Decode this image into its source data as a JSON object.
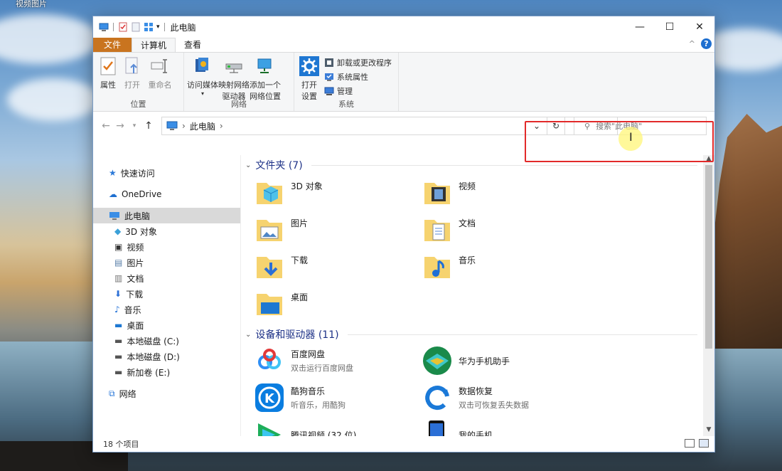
{
  "desktop": {
    "label": "视频图片"
  },
  "window": {
    "title": "此电脑",
    "controls": {
      "minimize": "—",
      "maximize": "☐",
      "close": "✕"
    }
  },
  "tabs": [
    {
      "label": "文件"
    },
    {
      "label": "计算机"
    },
    {
      "label": "查看"
    }
  ],
  "ribbon": {
    "groups": [
      {
        "label": "位置",
        "buttons": [
          "属性",
          "打开",
          "重命名"
        ]
      },
      {
        "label": "网络",
        "buttons": [
          "访问媒体",
          "映射网络\n驱动器",
          "添加一个\n网络位置"
        ]
      },
      {
        "label": "系统",
        "open": "打开\n设置",
        "items": [
          "卸载或更改程序",
          "系统属性",
          "管理"
        ]
      }
    ]
  },
  "address": {
    "crumbs": [
      "此电脑"
    ],
    "search_placeholder": "搜索\"此电脑\""
  },
  "nav": [
    {
      "label": "快速访问",
      "icon": "pin-icon"
    },
    {
      "label": "OneDrive",
      "icon": "cloud-icon"
    },
    {
      "label": "此电脑",
      "icon": "computer-icon"
    },
    {
      "label": "3D 对象",
      "icon": "cube-icon"
    },
    {
      "label": "视频",
      "icon": "film-icon"
    },
    {
      "label": "图片",
      "icon": "picture-icon"
    },
    {
      "label": "文档",
      "icon": "document-icon"
    },
    {
      "label": "下载",
      "icon": "download-icon"
    },
    {
      "label": "音乐",
      "icon": "music-icon"
    },
    {
      "label": "桌面",
      "icon": "desktop-icon"
    },
    {
      "label": "本地磁盘 (C:)",
      "icon": "drive-icon"
    },
    {
      "label": "本地磁盘 (D:)",
      "icon": "drive-icon"
    },
    {
      "label": "新加卷 (E:)",
      "icon": "drive-icon"
    },
    {
      "label": "网络",
      "icon": "network-icon"
    }
  ],
  "folders": {
    "header": "文件夹 (7)",
    "items": [
      {
        "name": "3D 对象",
        "icon": "cube-icon"
      },
      {
        "name": "视频",
        "icon": "film-icon"
      },
      {
        "name": "图片",
        "icon": "picture-icon"
      },
      {
        "name": "文档",
        "icon": "document-icon"
      },
      {
        "name": "下载",
        "icon": "download-icon"
      },
      {
        "name": "音乐",
        "icon": "music-icon"
      },
      {
        "name": "桌面",
        "icon": "desktop-icon"
      }
    ]
  },
  "devices": {
    "header": "设备和驱动器 (11)",
    "items": [
      {
        "name": "百度网盘",
        "sub": "双击运行百度网盘",
        "icon": "baidu-netdisk-icon",
        "color": "#2f8ff5"
      },
      {
        "name": "华为手机助手",
        "sub": "",
        "icon": "huawei-assistant-icon",
        "color": "#1a8a4a"
      },
      {
        "name": "酷狗音乐",
        "sub": "听音乐，用酷狗",
        "icon": "kugou-icon",
        "color": "#0a7de0"
      },
      {
        "name": "数据恢复",
        "sub": "双击可恢复丢失数据",
        "icon": "data-recovery-icon",
        "color": "#1a79d8"
      },
      {
        "name": "腾讯视频 (32 位)",
        "sub": "",
        "icon": "tencent-video-icon",
        "color": "#1dae5a"
      },
      {
        "name": "我的手机",
        "sub": "",
        "icon": "phone-icon",
        "color": "#2b6fd6"
      }
    ]
  },
  "status": {
    "count": "18 个项目"
  }
}
